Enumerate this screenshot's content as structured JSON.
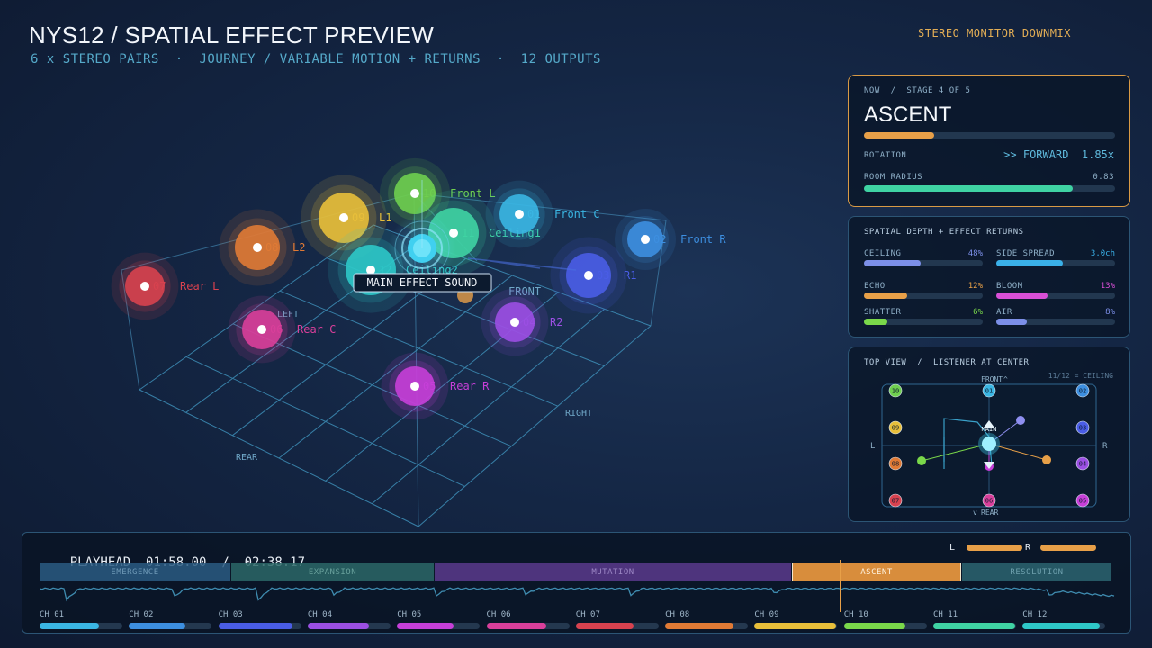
{
  "header": {
    "title": "NYS12 / SPATIAL EFFECT PREVIEW",
    "subtitle": "6 x STEREO PAIRS  ·  JOURNEY / VARIABLE MOTION + RETURNS  ·  12 OUTPUTS",
    "downmix_label": "STEREO MONITOR DOWNMIX"
  },
  "view": {
    "axis_labels": {
      "front": "FRONT",
      "left": "LEFT",
      "right": "RIGHT",
      "rear": "REAR"
    },
    "main_label": "MAIN EFFECT SOUND",
    "channels": [
      {
        "num": "01",
        "name": "Front C",
        "color": "#3ab6e3"
      },
      {
        "num": "02",
        "name": "Front R",
        "color": "#3d8fe0"
      },
      {
        "num": "03",
        "name": "R1",
        "color": "#4a5de6"
      },
      {
        "num": "04",
        "name": "R2",
        "color": "#9b4fe3"
      },
      {
        "num": "05",
        "name": "Rear R",
        "color": "#c63fd8"
      },
      {
        "num": "06",
        "name": "Rear C",
        "color": "#d93f9a"
      },
      {
        "num": "07",
        "name": "Rear L",
        "color": "#d8424f"
      },
      {
        "num": "08",
        "name": "L2",
        "color": "#e07a35"
      },
      {
        "num": "09",
        "name": "L1",
        "color": "#e8bf3a"
      },
      {
        "num": "10",
        "name": "Front L",
        "color": "#6fcf4f"
      },
      {
        "num": "11",
        "name": "Ceiling1",
        "color": "#3fd3a3"
      },
      {
        "num": "12",
        "name": "Ceiling2",
        "color": "#2ec8c8"
      }
    ]
  },
  "now_panel": {
    "breadcrumb": "NOW  /  STAGE 4 OF 5",
    "stage_name": "ASCENT",
    "stage_progress": 0.28,
    "rotation_label": "ROTATION",
    "rotation_value": ">> FORWARD  1.85x",
    "radius_label": "ROOM RADIUS",
    "radius_value": "0.83",
    "radius_fraction": 0.83,
    "accent": "#e8a048"
  },
  "depth_panel": {
    "title": "SPATIAL DEPTH + EFFECT RETURNS",
    "items": [
      {
        "label": "CEILING",
        "value": "48%",
        "fraction": 0.48,
        "color": "#7c8fe8"
      },
      {
        "label": "SIDE SPREAD",
        "value": "3.0ch",
        "fraction": 0.56,
        "color": "#3ab0e8"
      },
      {
        "label": "ECHO",
        "value": "12%",
        "fraction": 0.36,
        "color": "#e8a048"
      },
      {
        "label": "BLOOM",
        "value": "13%",
        "fraction": 0.43,
        "color": "#d94fd6"
      },
      {
        "label": "SHATTER",
        "value": "6%",
        "fraction": 0.2,
        "color": "#7ad84a"
      },
      {
        "label": "AIR",
        "value": "8%",
        "fraction": 0.26,
        "color": "#7c8fe8"
      }
    ]
  },
  "top_view": {
    "title": "TOP VIEW  /  LISTENER AT CENTER",
    "note": "11/12 = CEILING",
    "front": "FRONT",
    "rear": "REAR",
    "left": "L",
    "right": "R",
    "main": "MAIN",
    "markers": [
      "^",
      "v"
    ]
  },
  "timeline": {
    "playhead_label": "PLAYHEAD",
    "current": "01:58.00",
    "separator": "/",
    "total": "02:38.17",
    "meter_left": "L",
    "meter_right": "R",
    "stages": [
      {
        "name": "EMERGENCE",
        "color": "#2a5b82",
        "text": "#7fb0d0"
      },
      {
        "name": "EXPANSION",
        "color": "#2b6868",
        "text": "#79b9b0"
      },
      {
        "name": "MUTATION",
        "color": "#5a3a8c",
        "text": "#b59ae0"
      },
      {
        "name": "ASCENT",
        "color": "#d88d3c",
        "text": "#fff3e0"
      },
      {
        "name": "RESOLUTION",
        "color": "#2b6470",
        "text": "#7fb8c4"
      }
    ],
    "channels": [
      {
        "name": "CH 01",
        "level": 0.72,
        "color": "#3ab6e3"
      },
      {
        "name": "CH 02",
        "level": 0.68,
        "color": "#3d8fe0"
      },
      {
        "name": "CH 03",
        "level": 0.9,
        "color": "#4a5de6"
      },
      {
        "name": "CH 04",
        "level": 0.74,
        "color": "#9b4fe3"
      },
      {
        "name": "CH 05",
        "level": 0.68,
        "color": "#c63fd8"
      },
      {
        "name": "CH 06",
        "level": 0.72,
        "color": "#d93f9a"
      },
      {
        "name": "CH 07",
        "level": 0.7,
        "color": "#d8424f"
      },
      {
        "name": "CH 08",
        "level": 0.82,
        "color": "#e07a35"
      },
      {
        "name": "CH 09",
        "level": 0.98,
        "color": "#e8bf3a"
      },
      {
        "name": "CH 10",
        "level": 0.74,
        "color": "#7ad84a"
      },
      {
        "name": "CH 11",
        "level": 0.99,
        "color": "#3fd3a3"
      },
      {
        "name": "CH 12",
        "level": 0.93,
        "color": "#2ec8c8"
      }
    ]
  }
}
